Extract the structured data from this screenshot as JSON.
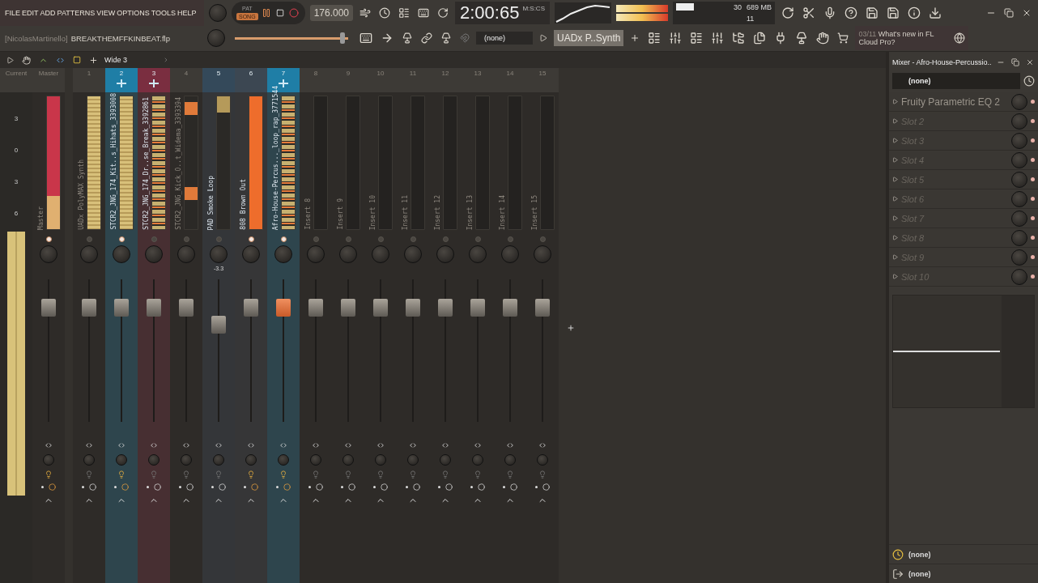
{
  "menu": [
    "FILE",
    "EDIT",
    "ADD",
    "PATTERNS",
    "VIEW",
    "OPTIONS",
    "TOOLS",
    "HELP"
  ],
  "project": {
    "user": "[NicolasMartinello]",
    "file": "BREAKTHEMFFKINBEAT.flp"
  },
  "transport": {
    "modes": [
      {
        "label": "PAT",
        "selected": false
      },
      {
        "label": "SONG",
        "selected": true
      }
    ],
    "tempo": "176.000",
    "time": "2:00:65",
    "time_unit": "M:S:CS"
  },
  "master_pitch": {
    "level": 0.95
  },
  "cpu": {
    "polyphony": "30",
    "memory": "689 MB",
    "voices": "11"
  },
  "pattern": "(none)",
  "channel": "UADx P..Synth",
  "news": {
    "date": "03/11",
    "text": "What's new in FL Cloud Pro?"
  },
  "mixer_toolbar": {
    "view": "Wide 3"
  },
  "current": {
    "header": "Current",
    "scale": [
      "3",
      "0",
      "3",
      "6"
    ]
  },
  "strips": [
    {
      "header": "Master",
      "name": "Master",
      "kind": "red",
      "lit": true,
      "linked": false,
      "selected": false,
      "level": 0.8
    },
    {
      "header": "1",
      "name": "UADx PolyMAX Synth",
      "kind": "wave",
      "lit": false,
      "linked": false,
      "selected": false,
      "level": 0.8
    },
    {
      "header": "2",
      "name": "STCR2_JNG_174_Kit..s_Hihats_3393008",
      "kind": "wave",
      "lit": true,
      "linked": true,
      "selected": false,
      "level": 0.8,
      "color": "#1f7ea6"
    },
    {
      "header": "3",
      "name": "STCR2_JNG_174_Dr..se_Break_3392861",
      "kind": "peaks",
      "lit": false,
      "linked": true,
      "selected": false,
      "level": 0.8,
      "color": "#7a2e40"
    },
    {
      "header": "4",
      "name": "STCR2_JNG_Kick_O..t_Widema_3393394",
      "kind": "blocks",
      "lit": false,
      "linked": false,
      "selected": false,
      "level": 0.8
    },
    {
      "header": "5",
      "name": "PAD Smoke Loop",
      "kind": "stub",
      "lit": false,
      "linked": false,
      "selected": false,
      "level": 0.68,
      "pan": "-3.3",
      "color": "#34495a"
    },
    {
      "header": "6",
      "name": "808 Brown Out",
      "kind": "solid",
      "lit": true,
      "linked": false,
      "selected": false,
      "level": 0.8,
      "color": "#3c4752"
    },
    {
      "header": "7",
      "name": "Afro-House-Percus..._loop_rap_3771544",
      "kind": "peaks",
      "lit": true,
      "linked": true,
      "selected": true,
      "level": 0.8,
      "color": "#1f7ea6"
    },
    {
      "header": "8",
      "name": "Insert 8",
      "kind": "empty",
      "lit": false,
      "linked": false,
      "selected": false,
      "level": 0.8
    },
    {
      "header": "9",
      "name": "Insert 9",
      "kind": "empty",
      "lit": false,
      "linked": false,
      "selected": false,
      "level": 0.8
    },
    {
      "header": "10",
      "name": "Insert 10",
      "kind": "empty",
      "lit": false,
      "linked": false,
      "selected": false,
      "level": 0.8
    },
    {
      "header": "11",
      "name": "Insert 11",
      "kind": "empty",
      "lit": false,
      "linked": false,
      "selected": false,
      "level": 0.8
    },
    {
      "header": "12",
      "name": "Insert 12",
      "kind": "empty",
      "lit": false,
      "linked": false,
      "selected": false,
      "level": 0.8
    },
    {
      "header": "13",
      "name": "Insert 13",
      "kind": "empty",
      "lit": false,
      "linked": false,
      "selected": false,
      "level": 0.8
    },
    {
      "header": "14",
      "name": "Insert 14",
      "kind": "empty",
      "lit": false,
      "linked": false,
      "selected": false,
      "level": 0.8
    },
    {
      "header": "15",
      "name": "Insert 15",
      "kind": "empty",
      "lit": false,
      "linked": false,
      "selected": false,
      "level": 0.8
    }
  ],
  "panel": {
    "title": "Mixer - Afro-House-Percussio..",
    "preset": "(none)",
    "slots": [
      {
        "name": "Fruity Parametric EQ 2",
        "empty": false
      },
      {
        "name": "Slot 2",
        "empty": true
      },
      {
        "name": "Slot 3",
        "empty": true
      },
      {
        "name": "Slot 4",
        "empty": true
      },
      {
        "name": "Slot 5",
        "empty": true
      },
      {
        "name": "Slot 6",
        "empty": true
      },
      {
        "name": "Slot 7",
        "empty": true
      },
      {
        "name": "Slot 8",
        "empty": true
      },
      {
        "name": "Slot 9",
        "empty": true
      },
      {
        "name": "Slot 10",
        "empty": true
      }
    ],
    "input": "(none)",
    "output": "(none)"
  }
}
